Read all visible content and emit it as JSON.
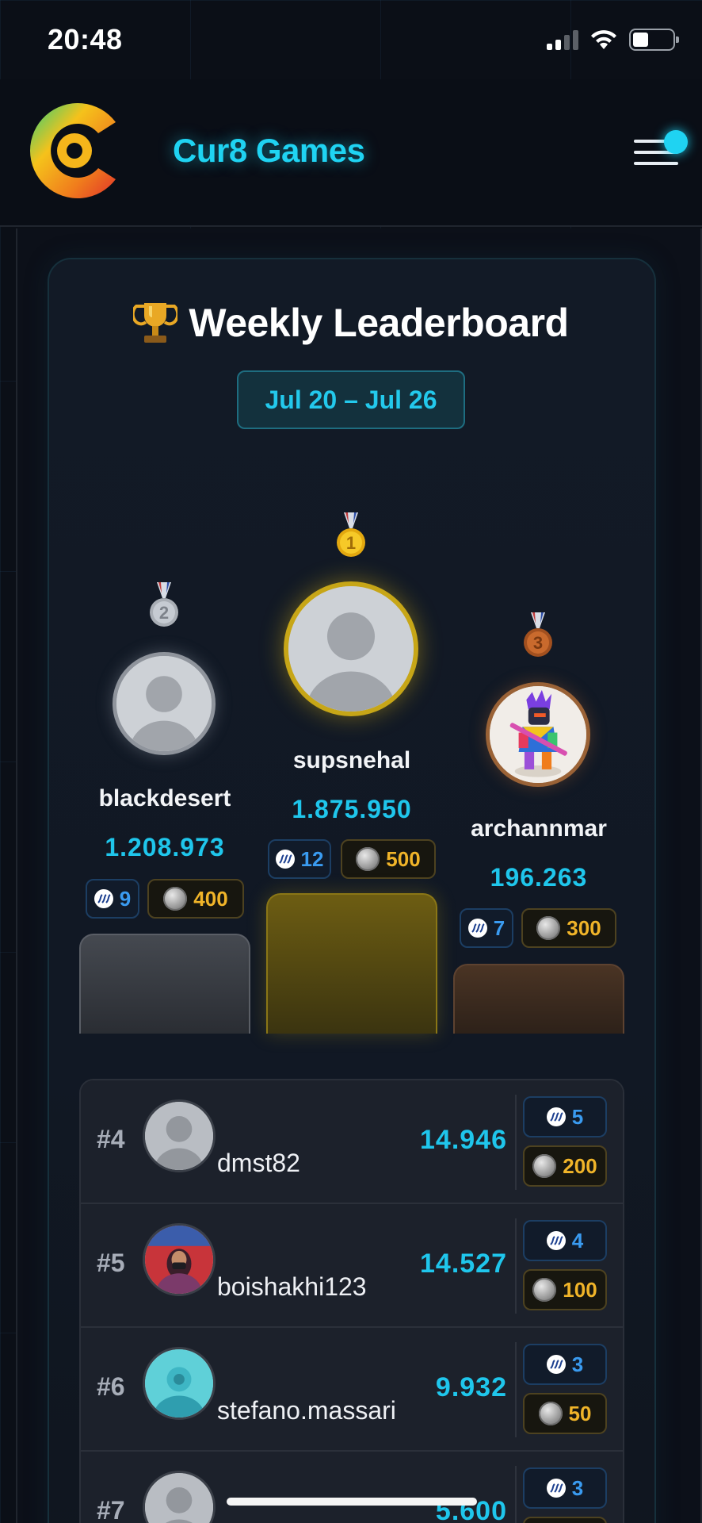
{
  "status_bar": {
    "time": "20:48"
  },
  "header": {
    "title": "Cur8 Games"
  },
  "leaderboard": {
    "title": "Weekly Leaderboard",
    "date_range": "Jul 20 – Jul 26",
    "podium": [
      {
        "place": "1",
        "name": "supsnehal",
        "score": "1.875.950",
        "steem": "12",
        "coins": "500",
        "avatar": "default-avatar"
      },
      {
        "place": "2",
        "name": "blackdesert",
        "score": "1.208.973",
        "steem": "9",
        "coins": "400",
        "avatar": "default-avatar"
      },
      {
        "place": "3",
        "name": "archannmar",
        "score": "196.263",
        "steem": "7",
        "coins": "300",
        "avatar": "warrior-avatar"
      }
    ],
    "rows": [
      {
        "rank": "#4",
        "name": "dmst82",
        "score": "14.946",
        "steem": "5",
        "coins": "200"
      },
      {
        "rank": "#5",
        "name": "boishakhi123",
        "score": "14.527",
        "steem": "4",
        "coins": "100"
      },
      {
        "rank": "#6",
        "name": "stefano.massari",
        "score": "9.932",
        "steem": "3",
        "coins": "50"
      },
      {
        "rank": "#7",
        "name": "",
        "score": "5.600",
        "steem": "3",
        "coins": ""
      }
    ]
  },
  "colors": {
    "accent": "#1fd3f2",
    "score": "#1fc6ec",
    "gold": "#f0b429",
    "steem_blue": "#3a9bf0",
    "background": "#0b0f17"
  }
}
